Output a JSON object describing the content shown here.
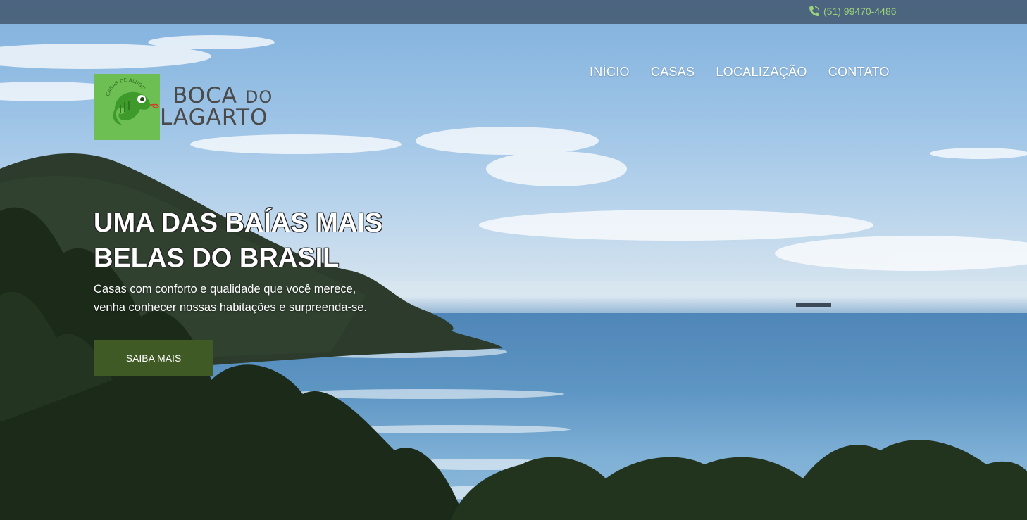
{
  "topbar": {
    "phone": "(51) 99470-4486",
    "phone_icon": "phone-icon"
  },
  "logo": {
    "badge_text": "CASAS DE ALUGUEL",
    "line1_word1": "BOCA",
    "line1_word2": "DO",
    "line2": "LAGARTO",
    "icon": "chameleon-logo-icon"
  },
  "nav": {
    "items": [
      "INÍCIO",
      "CASAS",
      "LOCALIZAÇÃO",
      "CONTATO"
    ]
  },
  "hero": {
    "headline_line1": "UMA DAS BAÍAS MAIS",
    "headline_line2": "BELAS DO BRASIL",
    "subtitle_line1": "Casas com conforto e qualidade que você merece,",
    "subtitle_line2": "venha conhecer nossas habitações e surpreenda-se.",
    "cta_label": "SAIBA MAIS"
  },
  "colors": {
    "accent_green": "#6dbf54",
    "button_green": "#3f5a24",
    "phone_green": "#9ad17a",
    "topbar": "#37465a"
  }
}
